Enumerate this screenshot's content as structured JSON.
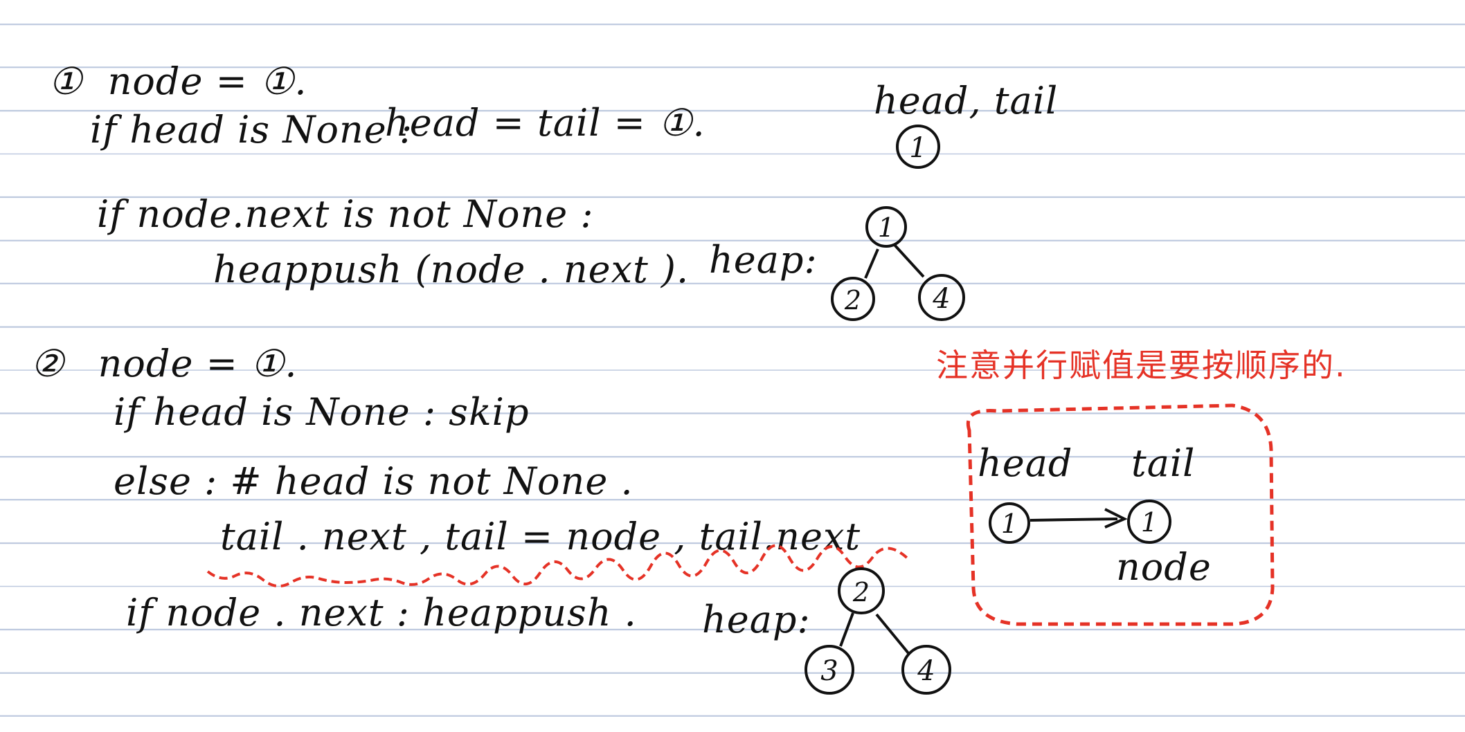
{
  "colors": {
    "ink": "#111111",
    "annotation_red": "#e53226",
    "rule_line": "#bcc8de",
    "paper": "#ffffff"
  },
  "step1": {
    "marker": "①",
    "line1": "node = ①.",
    "line2_cond": "if head is None :",
    "line2_assign": "head = tail = ①.",
    "line3": "if node.next is not None :",
    "line4": "heappush (node . next ).",
    "state_label": "head, tail",
    "state_node": "1",
    "heap_label": "heap:",
    "heap_nodes": [
      "1",
      "2",
      "4"
    ]
  },
  "step2": {
    "marker": "②",
    "line1": "node = ①.",
    "line2": "if head is None : skip",
    "line3": "else : # head is not None .",
    "line4": "tail . next , tail = node , tail.next",
    "line5": "if node . next : heappush .",
    "heap_label": "heap:",
    "heap_nodes": [
      "2",
      "3",
      "4"
    ]
  },
  "note": {
    "text": "注意并行赋值是要按顺序的.",
    "box_label_head": "head",
    "box_label_tail": "tail",
    "box_label_node": "node",
    "box_node_left": "1",
    "box_node_right": "1"
  }
}
